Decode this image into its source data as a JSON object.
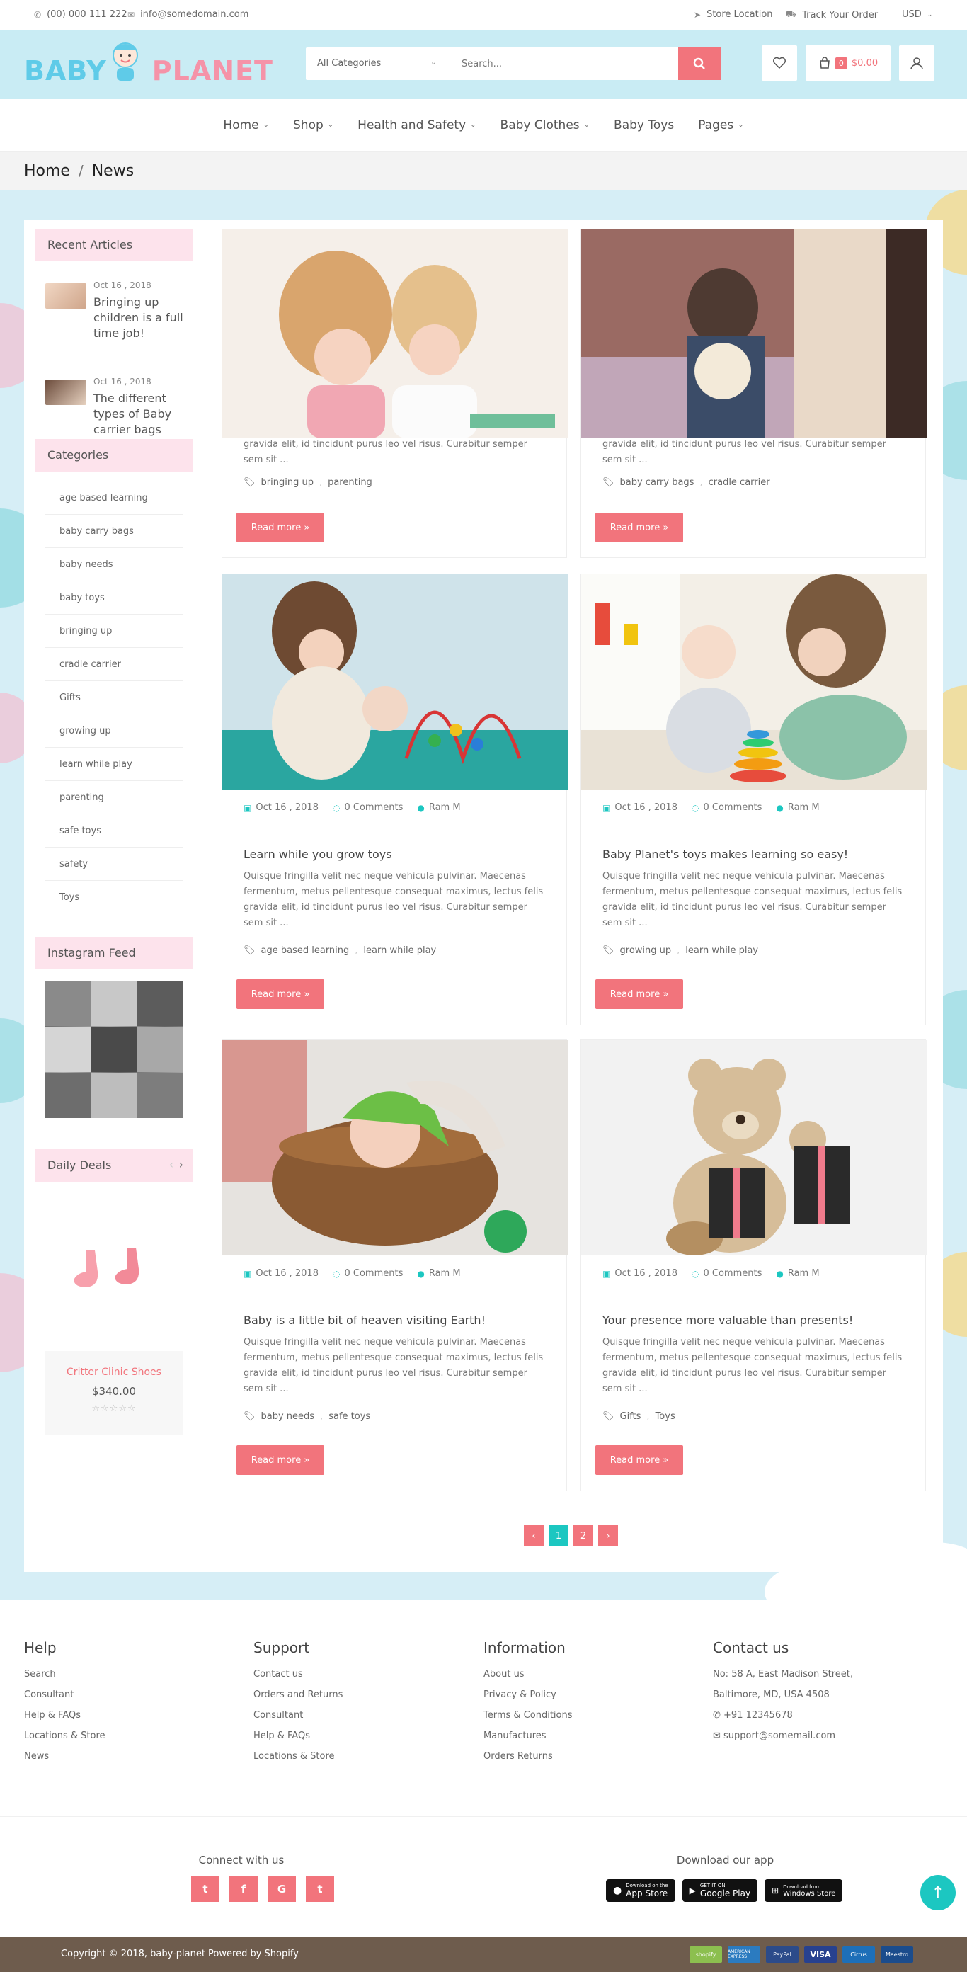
{
  "topbar": {
    "phone": "(00) 000 111 222",
    "email": "info@somedomain.com",
    "store_location": "Store Location",
    "track_order": "Track Your Order",
    "currency": "USD"
  },
  "header": {
    "logo_text_1": "BABY",
    "logo_text_2": "PLANET",
    "category_select": "All Categories",
    "search_placeholder": "Search...",
    "cart_count": "0",
    "cart_total": "$0.00"
  },
  "nav": {
    "items": [
      {
        "label": "Home",
        "dropdown": true
      },
      {
        "label": "Shop",
        "dropdown": true
      },
      {
        "label": "Health and Safety",
        "dropdown": true
      },
      {
        "label": "Baby Clothes",
        "dropdown": true
      },
      {
        "label": "Baby Toys",
        "dropdown": false
      },
      {
        "label": "Pages",
        "dropdown": true
      }
    ]
  },
  "breadcrumb": {
    "home": "Home",
    "sep": "/",
    "current": "News"
  },
  "sidebar": {
    "recent_title": "Recent Articles",
    "recent": [
      {
        "date": "Oct 16 , 2018",
        "title": "Bringing up children is a full time job!"
      },
      {
        "date": "Oct 16 , 2018",
        "title": "The different types of Baby carrier bags"
      }
    ],
    "categories_title": "Categories",
    "categories": [
      "age based learning",
      "baby carry bags",
      "baby needs",
      "baby toys",
      "bringing up",
      "cradle carrier",
      "Gifts",
      "growing up",
      "learn while play",
      "parenting",
      "safe toys",
      "safety",
      "Toys"
    ],
    "instagram_title": "Instagram Feed",
    "deals_title": "Daily Deals",
    "deal": {
      "name": "Critter Clinic Shoes",
      "price": "$340.00",
      "stars": "☆☆☆☆☆"
    }
  },
  "posts": [
    {
      "excerpt_tail": "gravida elit, id tincidunt purus leo vel risus. Curabitur semper sem sit ...",
      "tags": [
        "bringing up",
        "parenting"
      ],
      "read_more": "Read more »"
    },
    {
      "excerpt_tail": "gravida elit, id tincidunt purus leo vel risus. Curabitur semper sem sit ...",
      "tags": [
        "baby carry bags",
        "cradle carrier"
      ],
      "read_more": "Read more »"
    },
    {
      "date": "Oct 16 , 2018",
      "comments": "0 Comments",
      "author": "Ram M",
      "title": "Learn while you grow toys",
      "excerpt": "Quisque fringilla velit nec neque vehicula pulvinar. Maecenas fermentum, metus pellentesque consequat maximus, lectus felis gravida elit, id tincidunt purus leo vel risus. Curabitur semper sem sit ...",
      "tags": [
        "age based learning",
        "learn while play"
      ],
      "read_more": "Read more »"
    },
    {
      "date": "Oct 16 , 2018",
      "comments": "0 Comments",
      "author": "Ram M",
      "title": "Baby Planet's toys makes learning so easy!",
      "excerpt": "Quisque fringilla velit nec neque vehicula pulvinar. Maecenas fermentum, metus pellentesque consequat maximus, lectus felis gravida elit, id tincidunt purus leo vel risus. Curabitur semper sem sit ...",
      "tags": [
        "growing up",
        "learn while play"
      ],
      "read_more": "Read more »"
    },
    {
      "date": "Oct 16 , 2018",
      "comments": "0 Comments",
      "author": "Ram M",
      "title": "Baby is a little bit of heaven visiting Earth!",
      "excerpt": "Quisque fringilla velit nec neque vehicula pulvinar. Maecenas fermentum, metus pellentesque consequat maximus, lectus felis gravida elit, id tincidunt purus leo vel risus. Curabitur semper sem sit ...",
      "tags": [
        "baby needs",
        "safe toys"
      ],
      "read_more": "Read more »"
    },
    {
      "date": "Oct 16 , 2018",
      "comments": "0 Comments",
      "author": "Ram M",
      "title": "Your presence more valuable than presents!",
      "excerpt": "Quisque fringilla velit nec neque vehicula pulvinar. Maecenas fermentum, metus pellentesque consequat maximus, lectus felis gravida elit, id tincidunt purus leo vel risus. Curabitur semper sem sit ...",
      "tags": [
        "Gifts",
        "Toys"
      ],
      "read_more": "Read more »"
    }
  ],
  "pagination": {
    "prev": "‹",
    "pages": [
      "1",
      "2"
    ],
    "next": "›",
    "current": "1"
  },
  "footer": {
    "help": {
      "title": "Help",
      "links": [
        "Search",
        "Consultant",
        "Help & FAQs",
        "Locations & Store",
        "News"
      ]
    },
    "support": {
      "title": "Support",
      "links": [
        "Contact us",
        "Orders and Returns",
        "Consultant",
        "Help & FAQs",
        "Locations & Store"
      ]
    },
    "information": {
      "title": "Information",
      "links": [
        "About us",
        "Privacy & Policy",
        "Terms & Conditions",
        "Manufactures",
        "Orders Returns"
      ]
    },
    "contact": {
      "title": "Contact us",
      "address_1": "No: 58 A, East Madison Street,",
      "address_2": "Baltimore, MD, USA 4508",
      "phone": "+91 12345678",
      "email": "support@somemail.com"
    },
    "connect_title": "Connect with us",
    "download_title": "Download our app",
    "apps": [
      {
        "small": "Download on the",
        "big": "App Store"
      },
      {
        "small": "GET IT ON",
        "big": "Google Play"
      },
      {
        "small": "Download from",
        "big": "Windows Store"
      }
    ],
    "copyright": "Copyright © 2018, baby-planet Powered by Shopify",
    "payments": [
      "shopify",
      "AMERICAN EXPRESS",
      "PayPal",
      "VISA",
      "Cirrus",
      "Maestro"
    ]
  },
  "colors": {
    "accent": "#f2747c",
    "teal": "#1cc7c1",
    "header_bg": "#c9ecf4",
    "body_bg": "#d6eef6",
    "footer_bar": "#6e5c4d"
  }
}
